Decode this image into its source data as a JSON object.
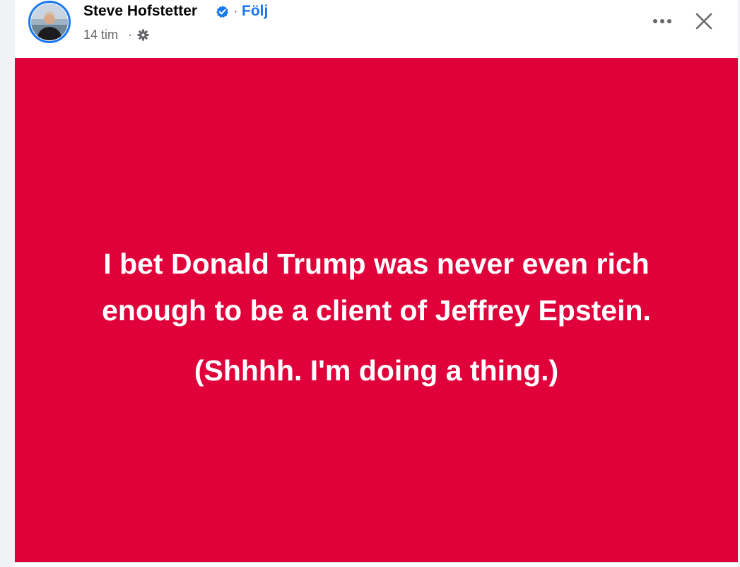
{
  "post": {
    "author": "Steve Hofstetter",
    "separator": "·",
    "follow_label": "Följ",
    "time": "14 tim",
    "time_separator": "·",
    "text_main": "I bet Donald Trump was never even rich enough to be a client of Jeffrey Epstein.",
    "text_sub": "(Shhhh. I'm doing a thing.)",
    "background_color": "#e0003a",
    "text_color": "#ffffff"
  },
  "icons": {
    "verified": "verified-badge-icon",
    "audience": "gear-icon",
    "more": "more-horizontal-icon",
    "close": "close-icon"
  },
  "colors": {
    "accent": "#1877f2",
    "secondary_text": "#65676b",
    "primary_text": "#050505"
  }
}
